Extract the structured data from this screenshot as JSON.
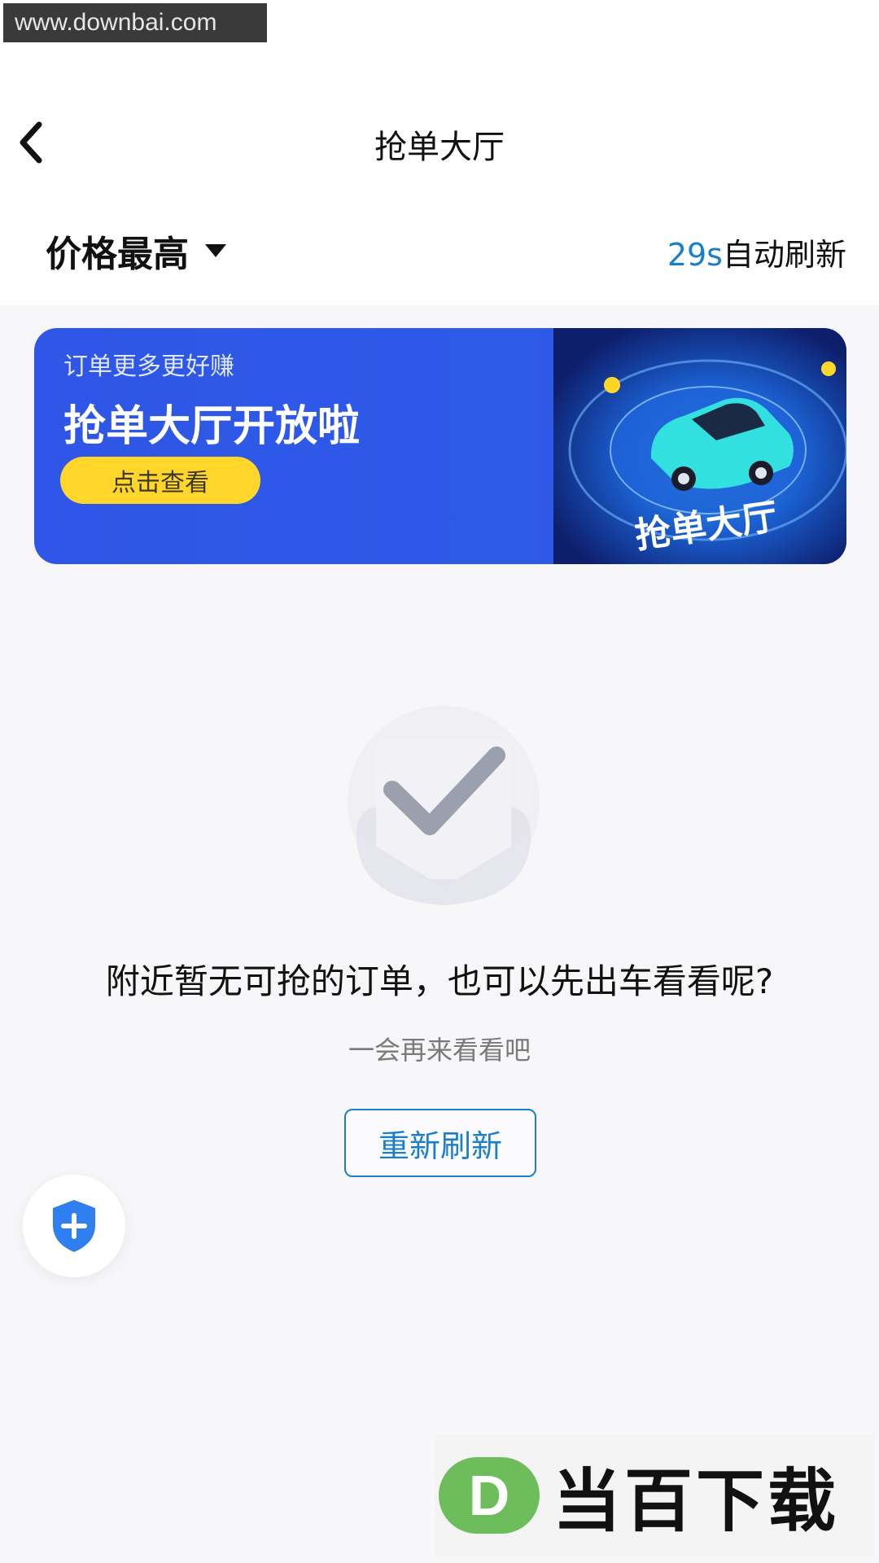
{
  "watermark_top": "www.downbai.com",
  "header": {
    "title": "抢单大厅",
    "sort_label": "价格最高",
    "refresh_countdown": "29s",
    "refresh_text": "自动刷新"
  },
  "banner": {
    "subtitle": "订单更多更好赚",
    "title": "抢单大厅开放啦",
    "cta": "点击查看",
    "art_text": "抢单大厅"
  },
  "empty_state": {
    "title": "附近暂无可抢的订单，也可以先出车看看呢?",
    "subtitle": "一会再来看看吧",
    "button": "重新刷新"
  },
  "watermark_bottom": {
    "logo_letter": "D",
    "text": "当百下载"
  },
  "colors": {
    "accent": "#1a7fc9",
    "banner_bg": "#2f56e6",
    "cta_bg": "#ffd629",
    "shield": "#2f7ff0"
  },
  "icons": {
    "back": "chevron-left-icon",
    "sort": "caret-down-icon",
    "empty": "check-document-icon",
    "fab": "shield-plus-icon"
  }
}
